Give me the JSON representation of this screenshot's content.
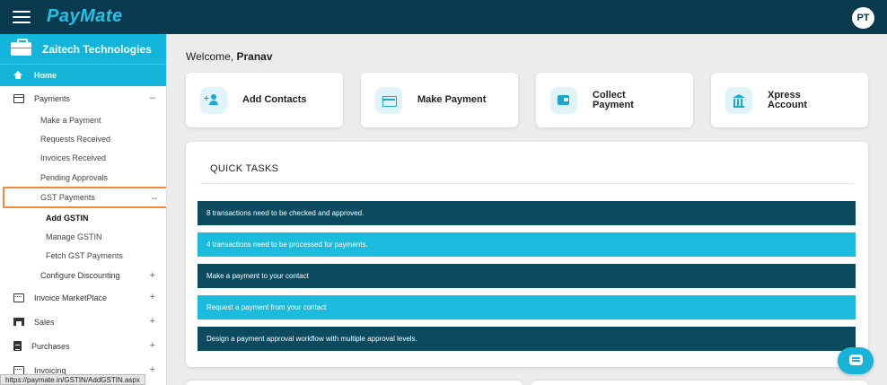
{
  "app": {
    "logo": "PayMate",
    "user_initials": "PT"
  },
  "sidebar": {
    "company": "Zaitech Technologies",
    "home": "Home",
    "payments": {
      "label": "Payments",
      "toggle": "–",
      "items": [
        "Make a Payment",
        "Requests Received",
        "Invoices Received",
        "Pending Approvals"
      ]
    },
    "gst": {
      "label": "GST Payments",
      "toggle": "–",
      "items": [
        "Add GSTIN",
        "Manage GSTIN",
        "Fetch GST Payments"
      ]
    },
    "configure": {
      "label": "Configure Discounting",
      "toggle": "+"
    },
    "sections": [
      {
        "label": "Invoice MarketPlace",
        "toggle": "+"
      },
      {
        "label": "Sales",
        "toggle": "+"
      },
      {
        "label": "Purchases",
        "toggle": "+"
      },
      {
        "label": "Invoicing",
        "toggle": "+"
      }
    ]
  },
  "status_url": "https://paymate.in/GSTIN/AddGSTIN.aspx",
  "main": {
    "welcome_prefix": "Welcome,",
    "welcome_name": "Pranav",
    "cards": [
      {
        "label": "Add Contacts",
        "icon": "add-contact-icon"
      },
      {
        "label": "Make Payment",
        "icon": "credit-card-icon"
      },
      {
        "label": "Collect Payment",
        "icon": "wallet-icon"
      },
      {
        "label": "Xpress Account",
        "icon": "bank-icon"
      }
    ],
    "quick_tasks": {
      "title": "QUICK TASKS",
      "items": [
        "8 transactions need to be checked and approved.",
        "4 transactions need to be processed for payments.",
        "Make a payment to your contact",
        "Request a payment from your contact",
        "Design a payment approval workflow with multiple approval levels."
      ]
    }
  },
  "colors": {
    "topbar": "#0a3a4d",
    "accent": "#13b6da",
    "dark_task": "#0b4a5f",
    "light_task": "#1bbbdd",
    "highlight": "#f08a3c"
  }
}
